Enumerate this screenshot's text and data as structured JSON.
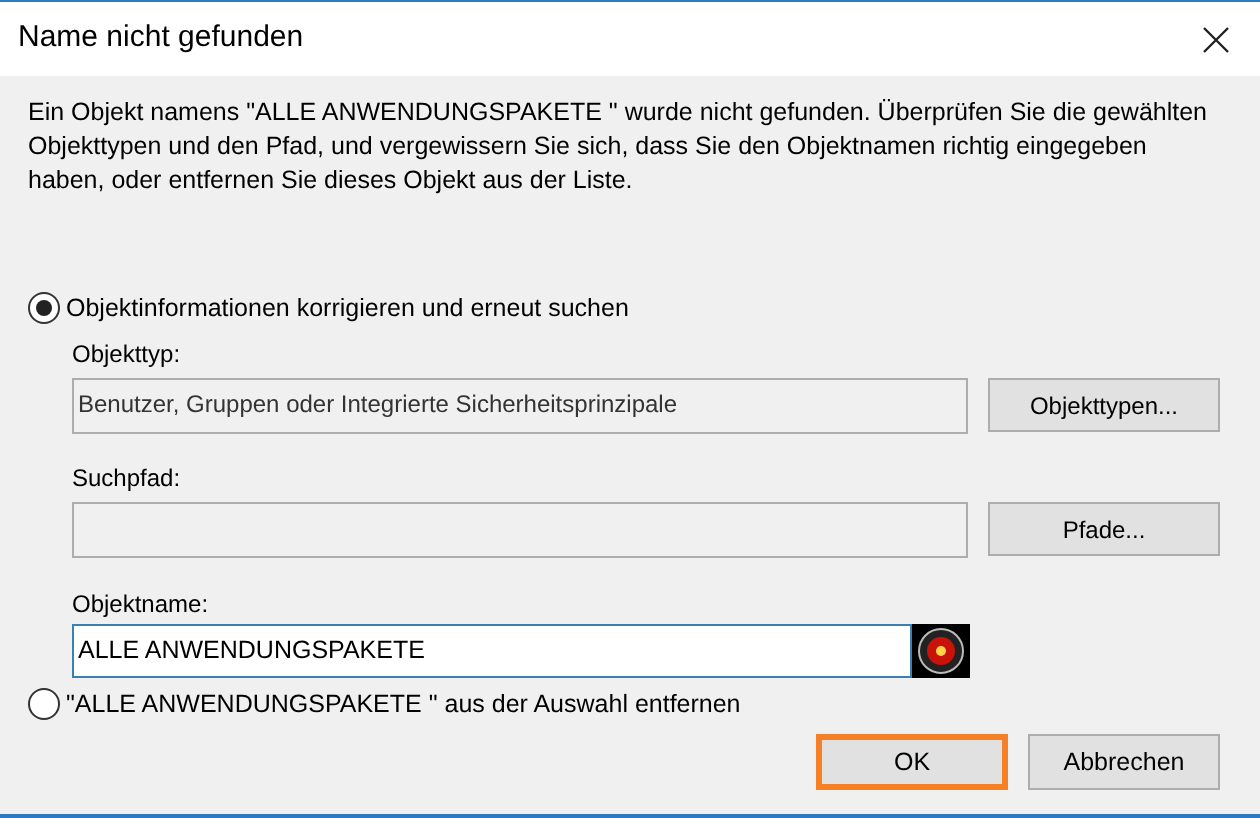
{
  "window": {
    "title": "Name nicht gefunden"
  },
  "message": "Ein Objekt namens \"ALLE ANWENDUNGSPAKETE \" wurde nicht gefunden. Überprüfen Sie die gewählten Objekttypen und den Pfad, und vergewissern Sie sich, dass Sie den Objektnamen richtig eingegeben haben, oder entfernen Sie dieses Objekt aus der Liste.",
  "options": [
    {
      "label": "Objektinformationen korrigieren und erneut suchen",
      "selected": true
    },
    {
      "label": "\"ALLE ANWENDUNGSPAKETE \" aus der Auswahl entfernen",
      "selected": false
    }
  ],
  "object_type": {
    "label": "Objekttyp:",
    "value": "Benutzer, Gruppen oder Integrierte Sicherheitsprinzipale",
    "button": "Objekttypen..."
  },
  "search_path": {
    "label": "Suchpfad:",
    "button": "Pfade..."
  },
  "object_name": {
    "label": "Objektname:",
    "value": "ALLE ANWENDUNGSPAKETE"
  },
  "buttons": [
    {
      "label": "OK",
      "highlighted": true
    },
    {
      "label": "Abbrechen",
      "highlighted": false
    }
  ]
}
